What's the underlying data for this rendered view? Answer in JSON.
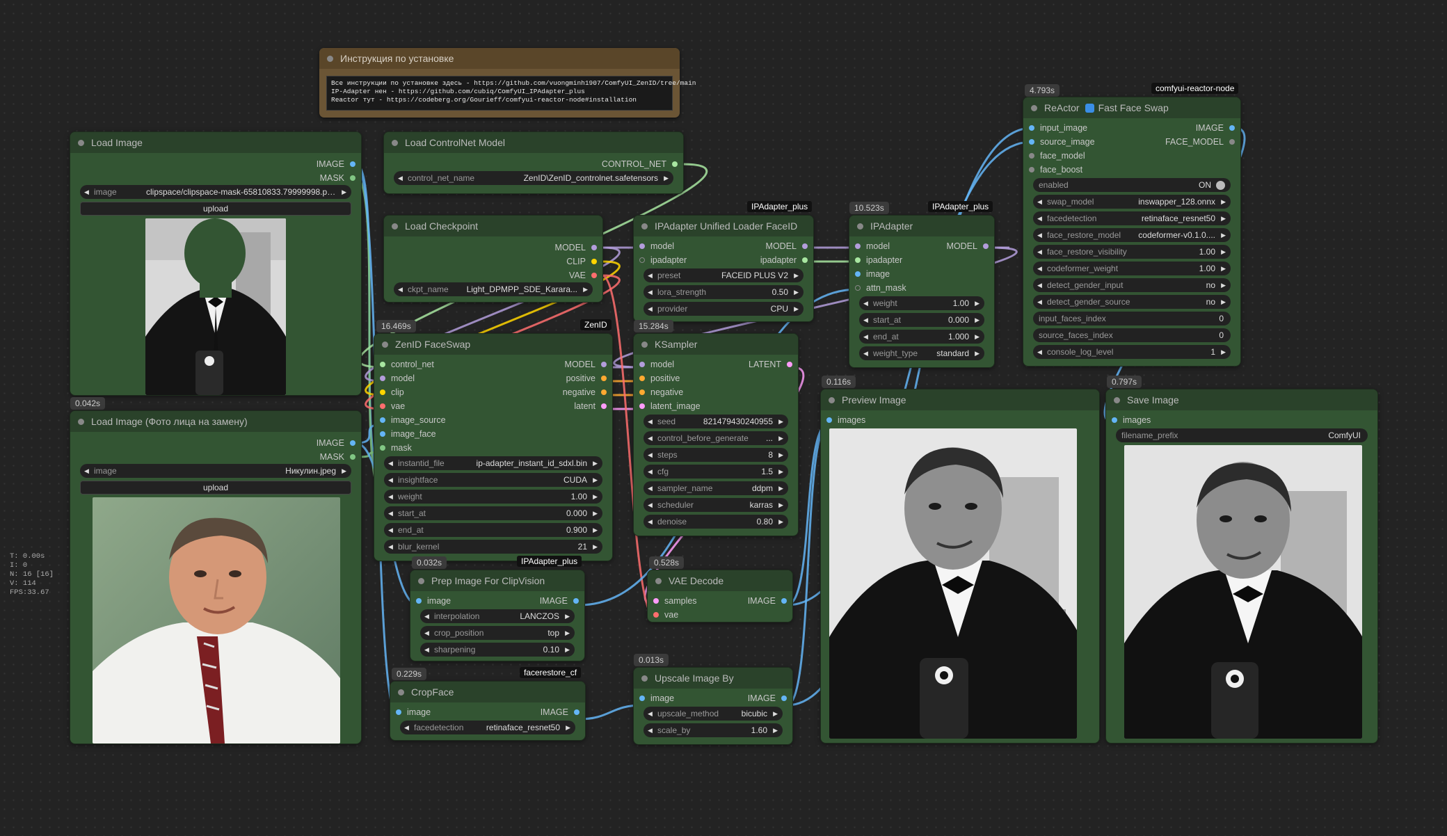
{
  "note": {
    "title": "Инструкция по установке",
    "lines": [
      "Все инструкции по установке здесь - https://github.com/vuongminh1907/ComfyUI_ZenID/tree/main",
      "IP-Adapter нен - https://github.com/cubiq/ComfyUI_IPAdapter_plus",
      "Reactor тут - https://codeberg.org/Gourieff/comfyui-reactor-node#installation"
    ]
  },
  "stats": [
    "T: 0.00s",
    "I: 0",
    "N: 16 [16]",
    "V: 114",
    "FPS:33.67"
  ],
  "colors": {
    "image": "#64b5f6",
    "mask": "#81c784",
    "model": "#b39ddb",
    "clip": "#ffd500",
    "vae": "#ff6e6e",
    "conditioning": "#ffa931",
    "latent": "#ff9cf9",
    "control_net": "#a8e6a1",
    "generic": "#a0a0a0"
  },
  "load_image": {
    "title": "Load Image",
    "out_image": "IMAGE",
    "out_mask": "MASK",
    "image_label": "image",
    "image_value": "clipspace/clipspace-mask-65810833.79999998.pn...",
    "upload": "upload",
    "badge": "0.042s"
  },
  "load_image2": {
    "title": "Load Image (Фото лица на замену)",
    "out_image": "IMAGE",
    "out_mask": "MASK",
    "image_label": "image",
    "image_value": "Никулин.jpeg",
    "upload": "upload"
  },
  "controlnet": {
    "title": "Load ControlNet Model",
    "out": "CONTROL_NET",
    "label": "control_net_name",
    "value": "ZenID\\ZenID_controlnet.safetensors"
  },
  "checkpoint": {
    "title": "Load Checkpoint",
    "out_model": "MODEL",
    "out_clip": "CLIP",
    "out_vae": "VAE",
    "label": "ckpt_name",
    "value": "Light_DPMPP_SDE_Karara..."
  },
  "zenid": {
    "title": "ZenID FaceSwap",
    "badge": "16.469s",
    "tag": "ZenID",
    "inputs": [
      "control_net",
      "model",
      "clip",
      "vae",
      "image_source",
      "image_face",
      "mask"
    ],
    "outputs": [
      "MODEL",
      "positive",
      "negative",
      "latent"
    ],
    "widgets": [
      {
        "l": "instantid_file",
        "v": "ip-adapter_instant_id_sdxl.bin"
      },
      {
        "l": "insightface",
        "v": "CUDA"
      },
      {
        "l": "weight",
        "v": "1.00"
      },
      {
        "l": "start_at",
        "v": "0.000"
      },
      {
        "l": "end_at",
        "v": "0.900"
      },
      {
        "l": "blur_kernel",
        "v": "21"
      }
    ]
  },
  "ipaloader": {
    "title": "IPAdapter Unified Loader FaceID",
    "tag": "IPAdapter_plus",
    "inputs": [
      "model",
      "ipadapter"
    ],
    "outputs": [
      "MODEL",
      "ipadapter"
    ],
    "widgets": [
      {
        "l": "preset",
        "v": "FACEID PLUS V2"
      },
      {
        "l": "lora_strength",
        "v": "0.50"
      },
      {
        "l": "provider",
        "v": "CPU"
      }
    ]
  },
  "ipadapter": {
    "title": "IPAdapter",
    "badge": "10.523s",
    "tag": "IPAdapter_plus",
    "inputs": [
      "model",
      "ipadapter",
      "image",
      "attn_mask"
    ],
    "outputs": [
      "MODEL"
    ],
    "widgets": [
      {
        "l": "weight",
        "v": "1.00"
      },
      {
        "l": "start_at",
        "v": "0.000"
      },
      {
        "l": "end_at",
        "v": "1.000"
      },
      {
        "l": "weight_type",
        "v": "standard"
      }
    ]
  },
  "ksampler": {
    "title": "KSampler",
    "badge": "15.284s",
    "inputs": [
      "model",
      "positive",
      "negative",
      "latent_image"
    ],
    "outputs": [
      "LATENT"
    ],
    "widgets": [
      {
        "l": "seed",
        "v": "821479430240955"
      },
      {
        "l": "control_before_generate",
        "v": "..."
      },
      {
        "l": "steps",
        "v": "8"
      },
      {
        "l": "cfg",
        "v": "1.5"
      },
      {
        "l": "sampler_name",
        "v": "ddpm"
      },
      {
        "l": "scheduler",
        "v": "karras"
      },
      {
        "l": "denoise",
        "v": "0.80"
      }
    ]
  },
  "reactor": {
    "title": "ReActor",
    "title2": "Fast Face Swap",
    "badge": "4.793s",
    "tag": "comfyui-reactor-node",
    "inputs": [
      "input_image",
      "source_image",
      "face_model",
      "face_boost"
    ],
    "outputs": [
      "IMAGE",
      "FACE_MODEL"
    ],
    "enabled_label": "enabled",
    "enabled_value": "ON",
    "widgets": [
      {
        "l": "swap_model",
        "v": "inswapper_128.onnx"
      },
      {
        "l": "facedetection",
        "v": "retinaface_resnet50"
      },
      {
        "l": "face_restore_model",
        "v": "codeformer-v0.1.0...."
      },
      {
        "l": "face_restore_visibility",
        "v": "1.00"
      },
      {
        "l": "codeformer_weight",
        "v": "1.00"
      },
      {
        "l": "detect_gender_input",
        "v": "no"
      },
      {
        "l": "detect_gender_source",
        "v": "no"
      }
    ],
    "plain": [
      {
        "l": "input_faces_index",
        "v": "0"
      },
      {
        "l": "source_faces_index",
        "v": "0"
      }
    ],
    "last": {
      "l": "console_log_level",
      "v": "1"
    }
  },
  "prep": {
    "title": "Prep Image For ClipVision",
    "badge": "0.032s",
    "tag": "IPAdapter_plus",
    "inputs": [
      "image"
    ],
    "outputs": [
      "IMAGE"
    ],
    "widgets": [
      {
        "l": "interpolation",
        "v": "LANCZOS"
      },
      {
        "l": "crop_position",
        "v": "top"
      },
      {
        "l": "sharpening",
        "v": "0.10"
      }
    ]
  },
  "vaedecode": {
    "title": "VAE Decode",
    "badge": "0.528s",
    "inputs": [
      "samples",
      "vae"
    ],
    "outputs": [
      "IMAGE"
    ]
  },
  "cropface": {
    "title": "CropFace",
    "badge": "0.229s",
    "tag": "facerestore_cf",
    "inputs": [
      "image"
    ],
    "outputs": [
      "IMAGE"
    ],
    "widgets": [
      {
        "l": "facedetection",
        "v": "retinaface_resnet50"
      }
    ]
  },
  "upscale": {
    "title": "Upscale Image By",
    "badge": "0.013s",
    "inputs": [
      "image"
    ],
    "outputs": [
      "IMAGE"
    ],
    "widgets": [
      {
        "l": "upscale_method",
        "v": "bicubic"
      },
      {
        "l": "scale_by",
        "v": "1.60"
      }
    ]
  },
  "preview": {
    "title": "Preview Image",
    "badge": "0.116s",
    "input": "images"
  },
  "save": {
    "title": "Save Image",
    "badge": "0.797s",
    "input": "images",
    "prefix_label": "filename_prefix",
    "prefix_value": "ComfyUI"
  }
}
